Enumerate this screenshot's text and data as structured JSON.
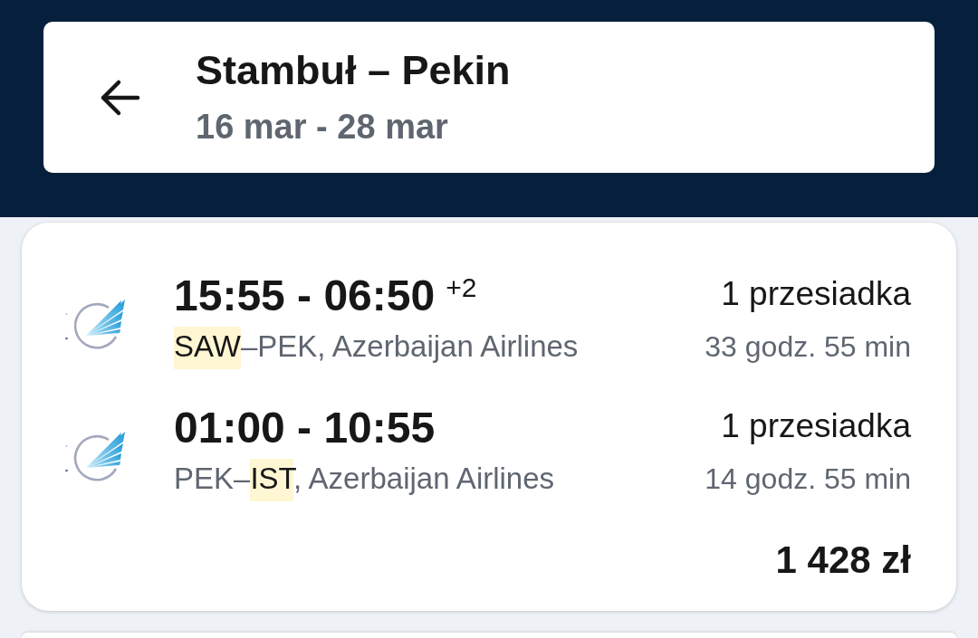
{
  "header": {
    "title": "Stambuł – Pekin",
    "dates": "16 mar - 28 mar"
  },
  "results": [
    {
      "legs": [
        {
          "times": "15:55 - 06:50",
          "day_offset": "+2",
          "route": [
            {
              "text": "SAW",
              "highlighted": true
            },
            {
              "text": "–PEK, Azerbaijan Airlines",
              "highlighted": false
            }
          ],
          "stops": "1 przesiadka",
          "duration": "33 godz. 55 min"
        },
        {
          "times": "01:00 - 10:55",
          "route": [
            {
              "text": "PEK–",
              "highlighted": false
            },
            {
              "text": "IST",
              "highlighted": true
            },
            {
              "text": ", Azerbaijan Airlines",
              "highlighted": false
            }
          ],
          "stops": "1 przesiadka",
          "duration": "14 godz. 55 min"
        }
      ],
      "price": "1 428 zł"
    }
  ]
}
